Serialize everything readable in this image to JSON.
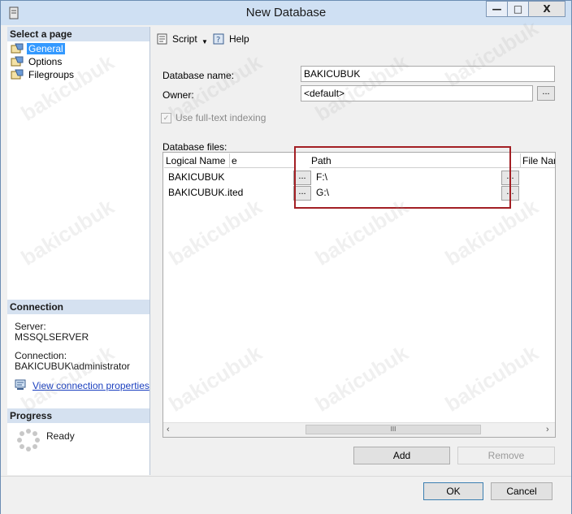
{
  "window": {
    "title": "New Database"
  },
  "left_pane": {
    "select_page_header": "Select a page",
    "pages": [
      {
        "label": "General",
        "selected": true
      },
      {
        "label": "Options",
        "selected": false
      },
      {
        "label": "Filegroups",
        "selected": false
      }
    ],
    "connection_header": "Connection",
    "server_label": "Server:",
    "server_value": "MSSQLSERVER",
    "connection_label": "Connection:",
    "connection_value": "BAKICUBUK\\administrator",
    "view_connection_link": "View connection properties",
    "progress_header": "Progress",
    "progress_status": "Ready"
  },
  "toolbar": {
    "script_label": "Script",
    "help_label": "Help"
  },
  "form": {
    "database_name_label": "Database name:",
    "database_name_value": "BAKICUBUK",
    "owner_label": "Owner:",
    "owner_value": "<default>",
    "owner_browse": "...",
    "fulltext_label": "Use full-text indexing",
    "database_files_label": "Database files:"
  },
  "grid": {
    "columns": [
      "Logical Name",
      "e",
      "Path",
      "File Name"
    ],
    "rows": [
      {
        "logical_name": "BAKICUBUK",
        "partial": "",
        "path": "F:\\"
      },
      {
        "logical_name": "BAKICUBUK...",
        "partial": "ited",
        "path": "G:\\"
      }
    ],
    "browse_label": "...",
    "scroll_thumb": "III"
  },
  "buttons": {
    "add": "Add",
    "remove": "Remove",
    "ok": "OK",
    "cancel": "Cancel"
  },
  "watermark": "bakicubuk",
  "colors": {
    "accent": "#3399ff",
    "highlight": "#a31f24",
    "link": "#1a3fbf"
  }
}
